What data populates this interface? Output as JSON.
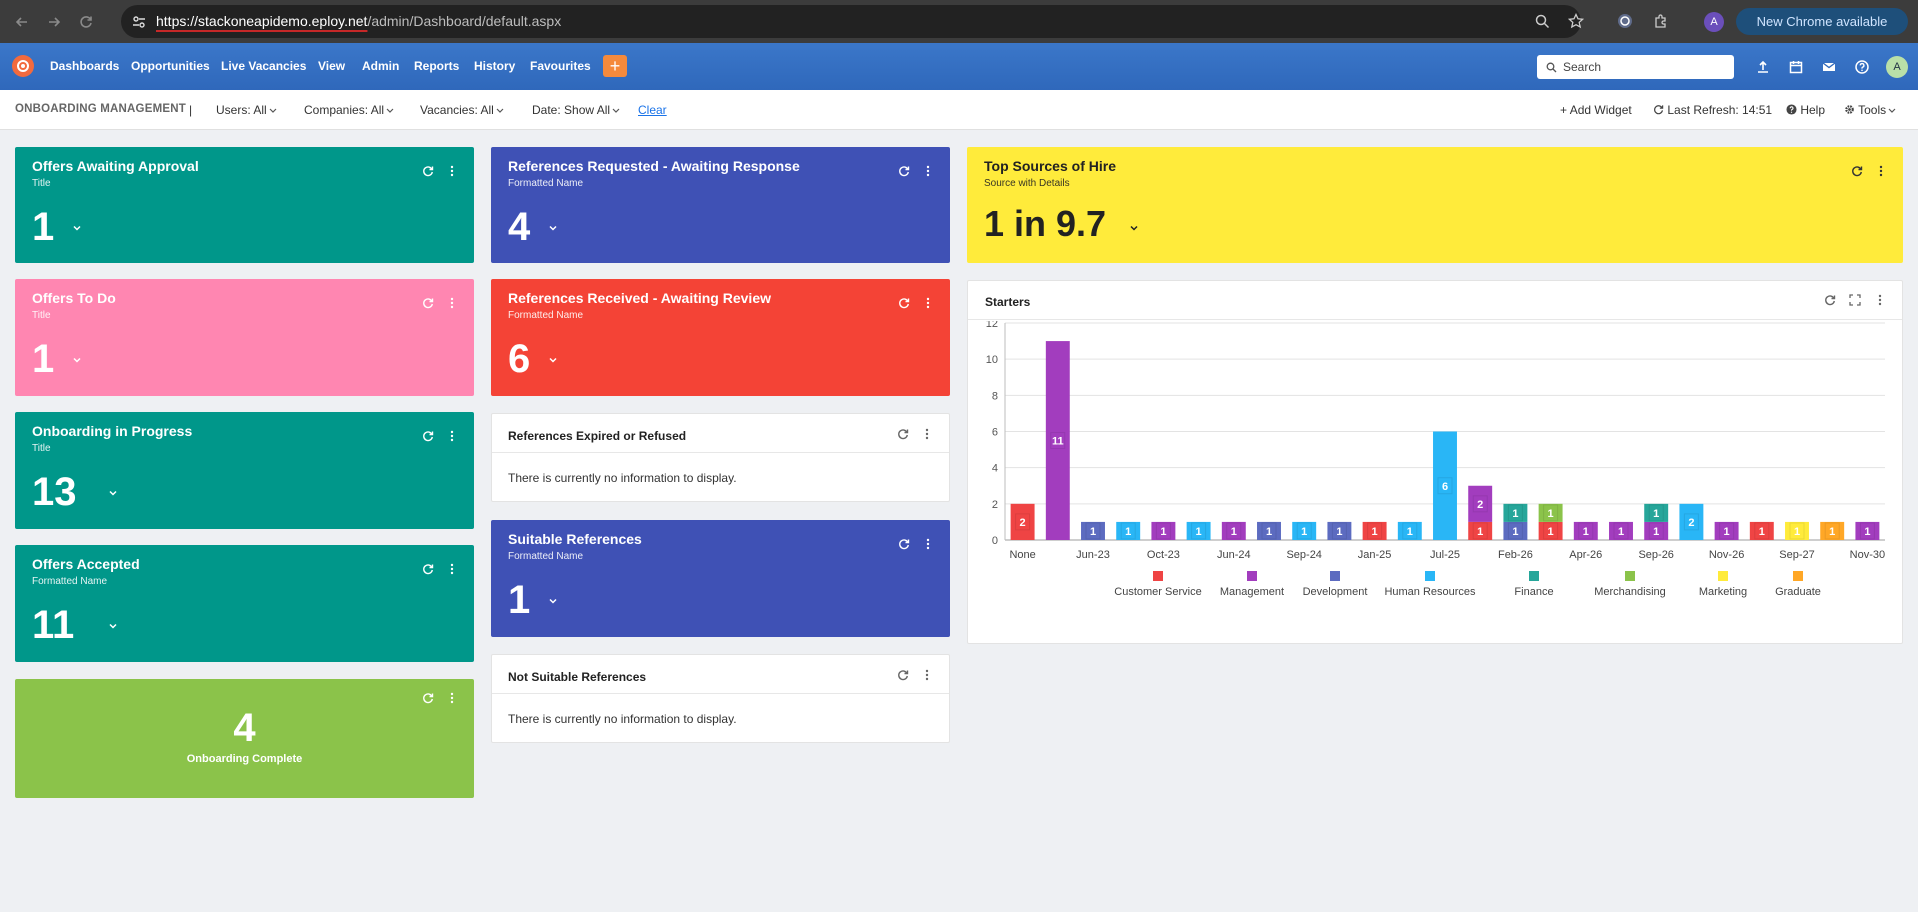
{
  "browser": {
    "url_host": "https://stackoneapidemo.eploy.net",
    "url_path": "/admin/Dashboard/default.aspx",
    "chrome_update": "New Chrome available",
    "profile_initial": "A"
  },
  "nav": {
    "items": [
      "Dashboards",
      "Opportunities",
      "Live Vacancies",
      "View",
      "Admin",
      "Reports",
      "History",
      "Favourites"
    ],
    "add_label": "+",
    "search_placeholder": "Search",
    "user_initial": "A"
  },
  "toolbar": {
    "title": "ONBOARDING MANAGEMENT",
    "separator": "|",
    "users": "Users: All",
    "companies": "Companies: All",
    "vacancies": "Vacancies: All",
    "date": "Date: Show All",
    "clear": "Clear",
    "add_widget": "Add Widget",
    "last_refresh": "Last Refresh: 14:51",
    "help": "Help",
    "tools": "Tools"
  },
  "widgets": {
    "offers_awaiting": {
      "title": "Offers Awaiting Approval",
      "sub": "Title",
      "value": "1"
    },
    "offers_todo": {
      "title": "Offers To Do",
      "sub": "Title",
      "value": "1"
    },
    "onboarding_progress": {
      "title": "Onboarding in Progress",
      "sub": "Title",
      "value": "13"
    },
    "offers_accepted": {
      "title": "Offers Accepted",
      "sub": "Formatted Name",
      "value": "11"
    },
    "onboarding_complete": {
      "value": "4",
      "label": "Onboarding Complete"
    },
    "refs_requested": {
      "title": "References Requested - Awaiting Response",
      "sub": "Formatted Name",
      "value": "4"
    },
    "refs_received": {
      "title": "References Received - Awaiting Review",
      "sub": "Formatted Name",
      "value": "6"
    },
    "refs_expired": {
      "title": "References Expired or Refused",
      "message": "There is currently no information to display."
    },
    "suitable_refs": {
      "title": "Suitable References",
      "sub": "Formatted Name",
      "value": "1"
    },
    "not_suitable_refs": {
      "title": "Not Suitable References",
      "message": "There is currently no information to display."
    },
    "top_sources": {
      "title": "Top Sources of Hire",
      "sub": "Source with Details",
      "value": "1 in 9.7"
    },
    "starters": {
      "title": "Starters"
    }
  },
  "colors": {
    "teal": "#00978a",
    "pink": "#ff86b1",
    "indigo": "#3f51b5",
    "red": "#f44336",
    "green": "#8bc34a",
    "yellow": "#ffeb3b"
  },
  "chart_data": {
    "type": "bar",
    "stacked": true,
    "title": "Starters",
    "ylim": [
      0,
      12
    ],
    "yticks": [
      0,
      2,
      4,
      6,
      8,
      10,
      12
    ],
    "grid": true,
    "legend_position": "bottom",
    "x_tick_labels": [
      "None",
      "Jun-23",
      "Oct-23",
      "Jun-24",
      "Sep-24",
      "Jan-25",
      "Jul-25",
      "Feb-26",
      "Apr-26",
      "Sep-26",
      "Nov-26",
      "Sep-27",
      "Nov-30"
    ],
    "series": [
      {
        "name": "Customer Service",
        "color": "#ef4444"
      },
      {
        "name": "Management",
        "color": "#a23dbe"
      },
      {
        "name": "Development",
        "color": "#5c6bc0"
      },
      {
        "name": "Human Resources",
        "color": "#29b6f6"
      },
      {
        "name": "Finance",
        "color": "#26a69a"
      },
      {
        "name": "Merchandising",
        "color": "#8bc34a"
      },
      {
        "name": "Marketing",
        "color": "#ffeb3b"
      },
      {
        "name": "Graduate",
        "color": "#ffa726"
      }
    ],
    "bars": [
      [
        {
          "s": 0,
          "v": 2
        }
      ],
      [
        {
          "s": 1,
          "v": 11
        }
      ],
      [
        {
          "s": 2,
          "v": 1
        }
      ],
      [
        {
          "s": 3,
          "v": 1
        }
      ],
      [
        {
          "s": 1,
          "v": 1
        }
      ],
      [
        {
          "s": 3,
          "v": 1
        }
      ],
      [
        {
          "s": 1,
          "v": 1
        }
      ],
      [
        {
          "s": 2,
          "v": 1
        }
      ],
      [
        {
          "s": 3,
          "v": 1
        }
      ],
      [
        {
          "s": 2,
          "v": 1
        }
      ],
      [
        {
          "s": 0,
          "v": 1
        }
      ],
      [
        {
          "s": 3,
          "v": 1
        }
      ],
      [
        {
          "s": 3,
          "v": 6
        }
      ],
      [
        {
          "s": 0,
          "v": 1
        },
        {
          "s": 1,
          "v": 2
        }
      ],
      [
        {
          "s": 2,
          "v": 1
        },
        {
          "s": 4,
          "v": 1
        }
      ],
      [
        {
          "s": 0,
          "v": 1
        },
        {
          "s": 5,
          "v": 1
        }
      ],
      [
        {
          "s": 1,
          "v": 1
        }
      ],
      [
        {
          "s": 1,
          "v": 1
        }
      ],
      [
        {
          "s": 1,
          "v": 1
        },
        {
          "s": 4,
          "v": 1
        }
      ],
      [
        {
          "s": 3,
          "v": 2
        }
      ],
      [
        {
          "s": 1,
          "v": 1
        }
      ],
      [
        {
          "s": 0,
          "v": 1
        }
      ],
      [
        {
          "s": 6,
          "v": 1
        }
      ],
      [
        {
          "s": 7,
          "v": 1
        }
      ],
      [
        {
          "s": 1,
          "v": 1
        }
      ]
    ]
  }
}
